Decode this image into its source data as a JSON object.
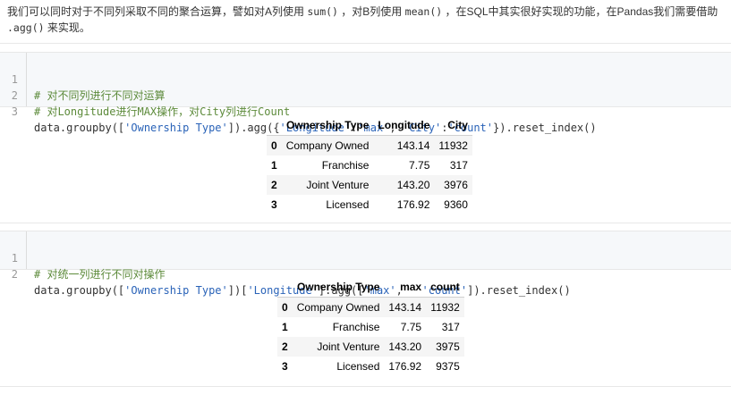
{
  "intro": {
    "line1": "我们可以同时对于不同列采取不同的聚合运算，譬如对A列使用 ",
    "sum": "sum()",
    "line1b": " ，对B列使用 ",
    "mean": "mean()",
    "line1c": " ，在SQL中其实很好实现的功能，在Pandas我们需要借助",
    "agg": ".agg()",
    "line2b": " 来实现。"
  },
  "code1": {
    "lines": [
      {
        "no": "1",
        "comment": "# 对不同列进行不同对运算"
      },
      {
        "no": "2",
        "comment": "# 对Longitude进行MAX操作，对City列进行Count"
      },
      {
        "no": "3",
        "p1": "data.groupby([",
        "s1": "'Ownership Type'",
        "p2": "]).agg({",
        "s2": "'Longitude'",
        "p3": ":",
        "s3": "'max'",
        "p4": ", ",
        "s4": "'City'",
        "p5": ":",
        "s5": "'count'",
        "p6": "}).reset_index()"
      }
    ]
  },
  "table1": {
    "headers": [
      "",
      "Ownership Type",
      "Longitude",
      "City"
    ],
    "rows": [
      [
        "0",
        "Company Owned",
        "143.14",
        "11932"
      ],
      [
        "1",
        "Franchise",
        "7.75",
        "317"
      ],
      [
        "2",
        "Joint Venture",
        "143.20",
        "3976"
      ],
      [
        "3",
        "Licensed",
        "176.92",
        "9360"
      ]
    ]
  },
  "code2": {
    "lines": [
      {
        "no": "1",
        "comment": "# 对统一列进行不同对操作"
      },
      {
        "no": "2",
        "p1": "data.groupby([",
        "s1": "'Ownership Type'",
        "p2": "])[",
        "s2": "'Longitude'",
        "p3": "].agg([",
        "s3": "'max'",
        "p4": ",   ",
        "s4": "'count'",
        "p5": "]).reset_index()"
      }
    ]
  },
  "table2": {
    "headers": [
      "",
      "Ownership Type",
      "max",
      "count"
    ],
    "rows": [
      [
        "0",
        "Company Owned",
        "143.14",
        "11932"
      ],
      [
        "1",
        "Franchise",
        "7.75",
        "317"
      ],
      [
        "2",
        "Joint Venture",
        "143.20",
        "3975"
      ],
      [
        "3",
        "Licensed",
        "176.92",
        "9375"
      ]
    ]
  }
}
